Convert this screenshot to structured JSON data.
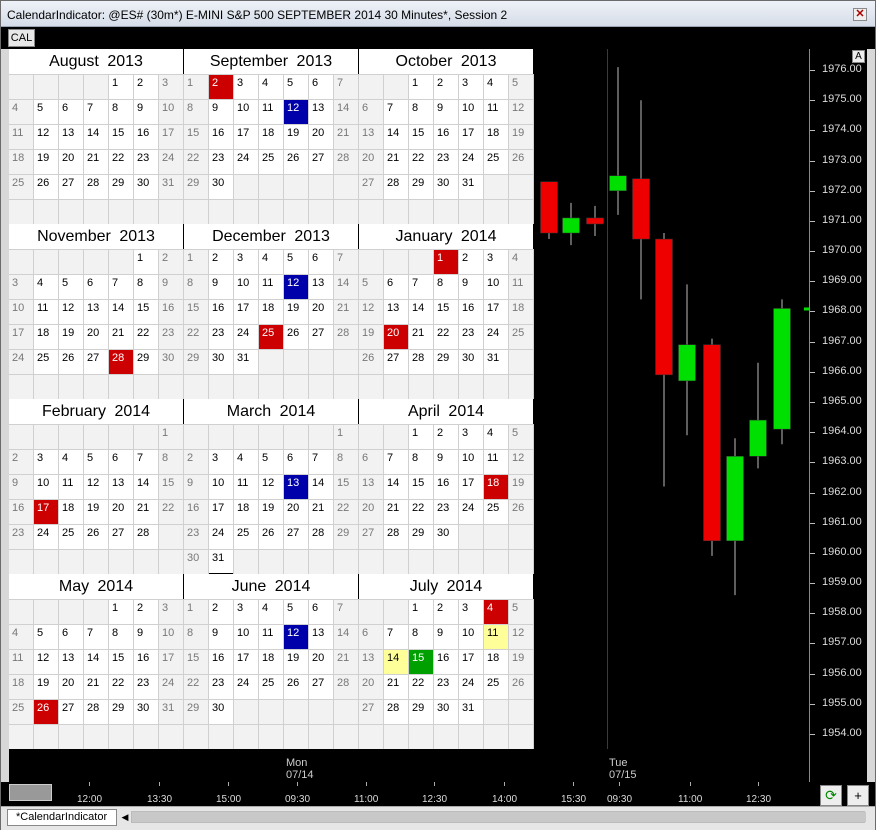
{
  "window": {
    "title": "CalendarIndicator: @ES# (30m*) E-MINI S&P 500 SEPTEMBER 2014 30 Minutes*, Session 2",
    "close_glyph": "✕"
  },
  "tab": {
    "label": "CAL"
  },
  "colors": {
    "red": "#cc0000",
    "blue": "#0000aa",
    "yellow": "#ffff99",
    "green": "#00a000",
    "bull": "#00e000",
    "bear": "#ee0000"
  },
  "calendar": {
    "months": [
      {
        "name": "August",
        "year": "2013",
        "first": 4,
        "days": 31,
        "marks": {}
      },
      {
        "name": "September",
        "year": "2013",
        "first": 0,
        "days": 30,
        "marks": {
          "2": "red",
          "12": "blue"
        }
      },
      {
        "name": "October",
        "year": "2013",
        "first": 2,
        "days": 31,
        "marks": {}
      },
      {
        "name": "November",
        "year": "2013",
        "first": 5,
        "days": 30,
        "marks": {
          "28": "red"
        }
      },
      {
        "name": "December",
        "year": "2013",
        "first": 0,
        "days": 31,
        "marks": {
          "12": "blue",
          "25": "red"
        }
      },
      {
        "name": "January",
        "year": "2014",
        "first": 3,
        "days": 31,
        "marks": {
          "1": "red",
          "20": "red"
        }
      },
      {
        "name": "February",
        "year": "2014",
        "first": 6,
        "days": 28,
        "marks": {
          "17": "red"
        }
      },
      {
        "name": "March",
        "year": "2014",
        "first": 6,
        "days": 31,
        "marks": {
          "13": "blue"
        }
      },
      {
        "name": "April",
        "year": "2014",
        "first": 2,
        "days": 30,
        "marks": {
          "18": "red"
        }
      },
      {
        "name": "May",
        "year": "2014",
        "first": 4,
        "days": 31,
        "marks": {
          "26": "red"
        }
      },
      {
        "name": "June",
        "year": "2014",
        "first": 0,
        "days": 30,
        "marks": {
          "12": "blue"
        }
      },
      {
        "name": "July",
        "year": "2014",
        "first": 2,
        "days": 31,
        "marks": {
          "4": "red",
          "11": "yel",
          "14": "yel",
          "15": "grn"
        }
      }
    ]
  },
  "chart_data": {
    "type": "candlestick",
    "ylim": [
      1953.5,
      1976.5
    ],
    "y_ticks": [
      "1954.00",
      "1955.00",
      "1956.00",
      "1957.00",
      "1958.00",
      "1959.00",
      "1960.00",
      "1961.00",
      "1962.00",
      "1963.00",
      "1964.00",
      "1965.00",
      "1966.00",
      "1967.00",
      "1968.00",
      "1969.00",
      "1970.00",
      "1971.00",
      "1972.00",
      "1973.00",
      "1974.00",
      "1975.00",
      "1976.00"
    ],
    "x_ticks": [
      "12:00",
      "13:30",
      "15:00",
      "09:30",
      "11:00",
      "12:30",
      "14:00",
      "15:30",
      "09:30",
      "11:00",
      "12:30"
    ],
    "day_labels": [
      {
        "day": "Mon",
        "date": "07/14"
      },
      {
        "day": "Tue",
        "date": "07/15"
      }
    ],
    "candles": [
      {
        "o": 1972.3,
        "h": 1972.3,
        "l": 1970.4,
        "c": 1970.6
      },
      {
        "o": 1970.6,
        "h": 1971.6,
        "l": 1970.2,
        "c": 1971.1
      },
      {
        "o": 1971.1,
        "h": 1971.5,
        "l": 1970.5,
        "c": 1970.9
      },
      {
        "o": 1972.0,
        "h": 1976.1,
        "l": 1971.2,
        "c": 1972.5
      },
      {
        "o": 1972.4,
        "h": 1975.0,
        "l": 1968.4,
        "c": 1970.4
      },
      {
        "o": 1970.4,
        "h": 1970.6,
        "l": 1962.2,
        "c": 1965.9
      },
      {
        "o": 1965.7,
        "h": 1968.9,
        "l": 1963.9,
        "c": 1966.9
      },
      {
        "o": 1966.9,
        "h": 1967.1,
        "l": 1959.9,
        "c": 1960.4
      },
      {
        "o": 1960.4,
        "h": 1963.8,
        "l": 1958.6,
        "c": 1963.2
      },
      {
        "o": 1963.2,
        "h": 1966.3,
        "l": 1962.8,
        "c": 1964.4
      },
      {
        "o": 1964.1,
        "h": 1968.4,
        "l": 1963.6,
        "c": 1968.1
      }
    ]
  },
  "buttons": {
    "autoscale": "A",
    "refresh": "⟳",
    "plus": "+"
  },
  "status": {
    "tab": "*CalendarIndicator",
    "scroll_left": "◀"
  }
}
